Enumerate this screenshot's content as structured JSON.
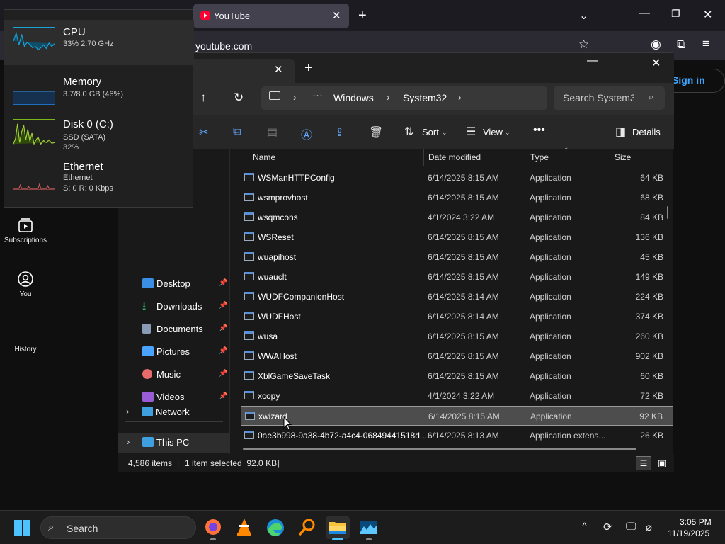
{
  "browser": {
    "tab_title": "YouTube",
    "url": "youtube.com",
    "signin_label": "Sign in",
    "sidebar": [
      {
        "label": "Subscriptions"
      },
      {
        "label": "You"
      },
      {
        "label": "History"
      }
    ]
  },
  "taskmgr": {
    "items": [
      {
        "title": "CPU",
        "sub1": "33% 2.70 GHz",
        "sub2": "",
        "color": "#17a2d8"
      },
      {
        "title": "Memory",
        "sub1": "3.7/8.0 GB (46%)",
        "sub2": "",
        "color": "#1f6fbf"
      },
      {
        "title": "Disk 0 (C:)",
        "sub1": "SSD (SATA)",
        "sub2": "32%",
        "color": "#7cb518"
      },
      {
        "title": "Ethernet",
        "sub1": "Ethernet",
        "sub2": "S: 0 R: 0 Kbps",
        "color": "#c05050"
      }
    ]
  },
  "explorer": {
    "breadcrumb": [
      "Windows",
      "System32"
    ],
    "search_placeholder": "Search System32",
    "toolbar": {
      "sort": "Sort",
      "view": "View",
      "details": "Details"
    },
    "nav": [
      {
        "label": "Desktop",
        "color": "#3a8ee6"
      },
      {
        "label": "Downloads",
        "color": "#29b36b"
      },
      {
        "label": "Documents",
        "color": "#8a9bb5"
      },
      {
        "label": "Pictures",
        "color": "#4aa3ff"
      },
      {
        "label": "Music",
        "color": "#e96a6a"
      },
      {
        "label": "Videos",
        "color": "#9a5cd6"
      }
    ],
    "tree": [
      {
        "label": "This PC"
      },
      {
        "label": "Network"
      }
    ],
    "columns": {
      "name": "Name",
      "date": "Date modified",
      "type": "Type",
      "size": "Size"
    },
    "files": [
      {
        "name": "WSManHTTPConfig",
        "date": "6/14/2025 8:15 AM",
        "type": "Application",
        "size": "64 KB"
      },
      {
        "name": "wsmprovhost",
        "date": "6/14/2025 8:15 AM",
        "type": "Application",
        "size": "68 KB"
      },
      {
        "name": "wsqmcons",
        "date": "4/1/2024 3:22 AM",
        "type": "Application",
        "size": "84 KB"
      },
      {
        "name": "WSReset",
        "date": "6/14/2025 8:15 AM",
        "type": "Application",
        "size": "136 KB"
      },
      {
        "name": "wuapihost",
        "date": "6/14/2025 8:15 AM",
        "type": "Application",
        "size": "45 KB"
      },
      {
        "name": "wuauclt",
        "date": "6/14/2025 8:15 AM",
        "type": "Application",
        "size": "149 KB"
      },
      {
        "name": "WUDFCompanionHost",
        "date": "6/14/2025 8:14 AM",
        "type": "Application",
        "size": "224 KB"
      },
      {
        "name": "WUDFHost",
        "date": "6/14/2025 8:14 AM",
        "type": "Application",
        "size": "374 KB"
      },
      {
        "name": "wusa",
        "date": "6/14/2025 8:15 AM",
        "type": "Application",
        "size": "260 KB"
      },
      {
        "name": "WWAHost",
        "date": "6/14/2025 8:15 AM",
        "type": "Application",
        "size": "902 KB"
      },
      {
        "name": "XblGameSaveTask",
        "date": "6/14/2025 8:15 AM",
        "type": "Application",
        "size": "60 KB"
      },
      {
        "name": "xcopy",
        "date": "4/1/2024 3:22 AM",
        "type": "Application",
        "size": "72 KB"
      },
      {
        "name": "xwizard",
        "date": "6/14/2025 8:15 AM",
        "type": "Application",
        "size": "92 KB",
        "selected": true
      },
      {
        "name": "0ae3b998-9a38-4b72-a4c4-06849441518d...",
        "date": "6/14/2025 8:13 AM",
        "type": "Application extens...",
        "size": "26 KB"
      }
    ],
    "status": {
      "count": "4,586 items",
      "selected": "1 item selected  92.0 KB"
    }
  },
  "taskbar": {
    "search_label": "Search",
    "time": "3:05 PM",
    "date": "11/19/2025"
  }
}
